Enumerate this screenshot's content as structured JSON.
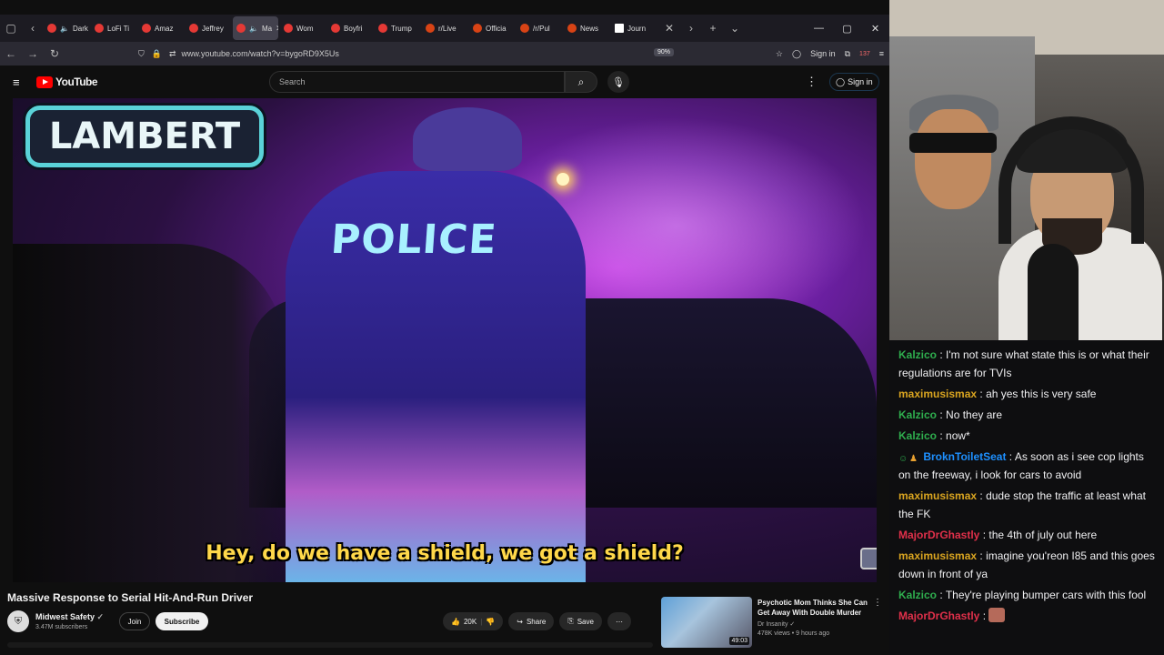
{
  "browser": {
    "tabs": [
      {
        "label": "Dark S",
        "favicon": "youtube-icon",
        "muted": true
      },
      {
        "label": "LoFi Ti",
        "favicon": "youtube-icon"
      },
      {
        "label": "Amaz",
        "favicon": "youtube-icon"
      },
      {
        "label": "Jeffrey",
        "favicon": "youtube-icon"
      },
      {
        "label": "Ma",
        "favicon": "youtube-icon",
        "active": true,
        "muted": true
      },
      {
        "label": "Wom",
        "favicon": "youtube-icon"
      },
      {
        "label": "Boyfri",
        "favicon": "youtube-icon"
      },
      {
        "label": "Trump",
        "favicon": "youtube-icon"
      },
      {
        "label": "r/Live",
        "favicon": "reddit-icon"
      },
      {
        "label": "Officia",
        "favicon": "reddit-icon"
      },
      {
        "label": "/r/Pul",
        "favicon": "reddit-icon"
      },
      {
        "label": "News",
        "favicon": "reddit-icon"
      },
      {
        "label": "Journ",
        "favicon": "ap-icon"
      }
    ],
    "url": "www.youtube.com/watch?v=bygoRD9X5Us",
    "zoom": "90%",
    "signin": "Sign in",
    "badge_count": "137"
  },
  "youtube": {
    "logo": "YouTube",
    "search_placeholder": "Search",
    "signin": "Sign in",
    "video": {
      "overlay_name": "LAMBERT",
      "vest_text": "POLICE",
      "caption": "Hey, do we have a shield, we got a shield?"
    },
    "title": "Massive Response to Serial Hit-And-Run Driver",
    "channel": "Midwest Safety",
    "subscribers": "3.47M subscribers",
    "join": "Join",
    "subscribe": "Subscribe",
    "likes": "20K",
    "share": "Share",
    "save": "Save",
    "recommendation": {
      "title": "Psychotic Mom Thinks She Can Get Away With Double Murder",
      "channel": "Dr Insanity",
      "meta": "478K views • 9 hours ago",
      "duration": "49:03"
    }
  },
  "chat": [
    {
      "user": "Kalzico",
      "color": "#2fae4e",
      "text": "I'm not sure what state this is or what their regulations are for TVIs"
    },
    {
      "user": "maximusismax",
      "color": "#daa520",
      "text": "ah yes this is very safe"
    },
    {
      "user": "Kalzico",
      "color": "#2fae4e",
      "text": "No they are"
    },
    {
      "user": "Kalzico",
      "color": "#2fae4e",
      "text": "now*"
    },
    {
      "user": "BroknToiletSeat",
      "color": "#1e90ff",
      "text": "As soon as i see cop lights on the freeway, i look for cars to avoid",
      "badges": true
    },
    {
      "user": "maximusismax",
      "color": "#daa520",
      "text": "dude stop the traffic at least what the FK"
    },
    {
      "user": "MajorDrGhastly",
      "color": "#e0304a",
      "text": "the 4th of july out here"
    },
    {
      "user": "maximusismax",
      "color": "#daa520",
      "text": "imagine you'reon I85 and this goes down in front of ya"
    },
    {
      "user": "Kalzico",
      "color": "#2fae4e",
      "text": "They're playing bumper cars with this fool"
    },
    {
      "user": "MajorDrGhastly",
      "color": "#e0304a",
      "text": "",
      "emote": true
    }
  ]
}
